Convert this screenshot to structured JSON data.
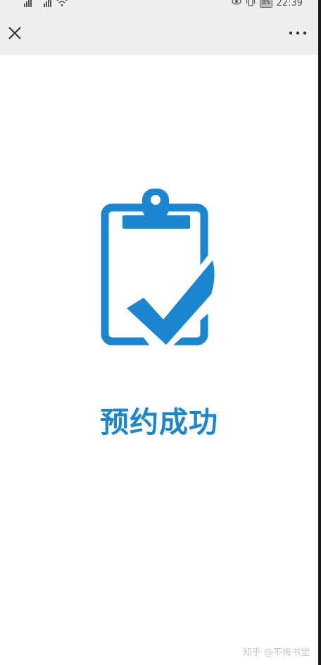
{
  "status_bar": {
    "battery": "85",
    "time": "22:39"
  },
  "toolbar": {
    "close_icon": "close-icon",
    "more_icon": "more-horizontal-icon"
  },
  "main": {
    "icon": "clipboard-check-icon",
    "title": "预约成功"
  },
  "watermark": "知乎 @不悔书堂",
  "colors": {
    "accent": "#1a86d0",
    "toolbar_bg": "#efefef",
    "background": "#ffffff"
  }
}
